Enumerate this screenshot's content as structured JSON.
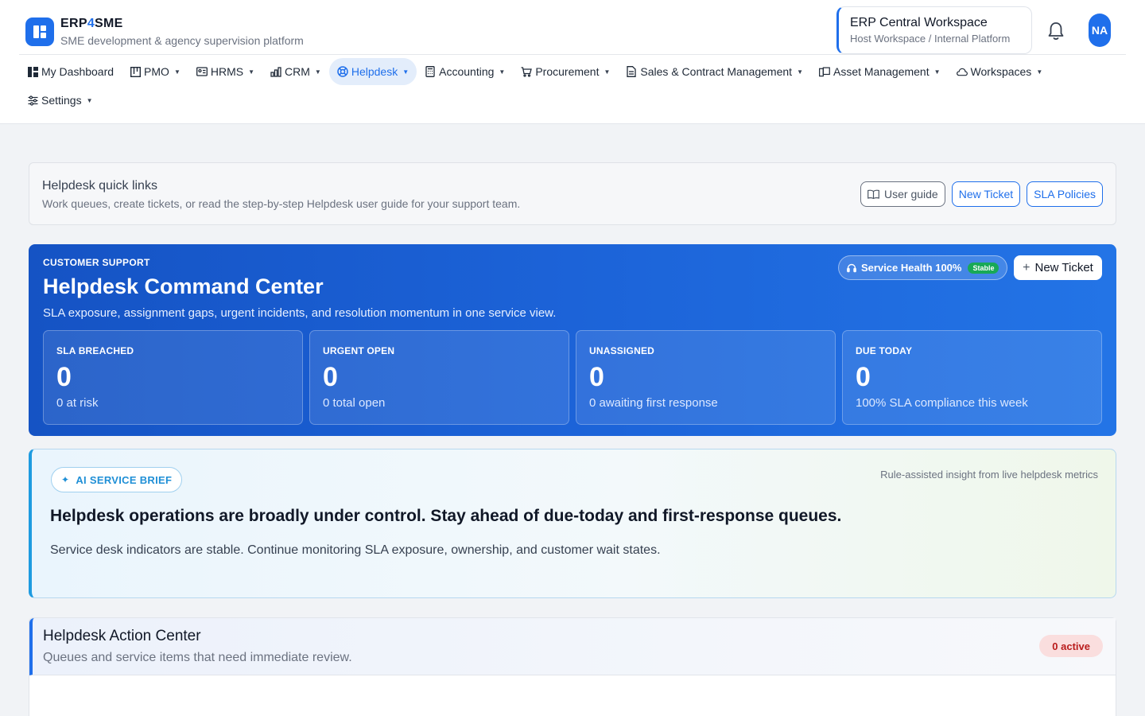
{
  "brand": {
    "name_prefix": "ERP",
    "name_four": "4",
    "name_suffix": "SME",
    "subtitle": "SME development & agency supervision platform",
    "color": "#1f6feb"
  },
  "workspace": {
    "title": "ERP Central Workspace",
    "subtitle": "Host Workspace / Internal Platform"
  },
  "user": {
    "initials": "NA"
  },
  "nav": {
    "items": [
      {
        "label": "My Dashboard",
        "icon": "dashboard-icon",
        "dropdown": false,
        "active": false
      },
      {
        "label": "PMO",
        "icon": "kanban-icon",
        "dropdown": true,
        "active": false
      },
      {
        "label": "HRMS",
        "icon": "id-card-icon",
        "dropdown": true,
        "active": false
      },
      {
        "label": "CRM",
        "icon": "bar-chart-icon",
        "dropdown": true,
        "active": false
      },
      {
        "label": "Helpdesk",
        "icon": "lifebuoy-icon",
        "dropdown": true,
        "active": true
      },
      {
        "label": "Accounting",
        "icon": "calculator-icon",
        "dropdown": true,
        "active": false
      },
      {
        "label": "Procurement",
        "icon": "cart-icon",
        "dropdown": true,
        "active": false
      },
      {
        "label": "Sales & Contract Management",
        "icon": "document-icon",
        "dropdown": true,
        "active": false
      },
      {
        "label": "Asset Management",
        "icon": "devices-icon",
        "dropdown": true,
        "active": false
      },
      {
        "label": "Workspaces",
        "icon": "cloud-icon",
        "dropdown": true,
        "active": false
      },
      {
        "label": "Settings",
        "icon": "sliders-icon",
        "dropdown": true,
        "active": false
      }
    ]
  },
  "quick_links": {
    "title": "Helpdesk quick links",
    "subtitle": "Work queues, create tickets, or read the step-by-step Helpdesk user guide for your support team.",
    "user_guide": "User guide",
    "new_ticket": "New Ticket",
    "sla_policies": "SLA Policies"
  },
  "command_center": {
    "eyebrow": "CUSTOMER SUPPORT",
    "title": "Helpdesk Command Center",
    "subtitle": "SLA exposure, assignment gaps, urgent incidents, and resolution momentum in one service view.",
    "health_label": "Service Health 100%",
    "health_badge": "Stable",
    "new_ticket": "New Ticket",
    "kpis": [
      {
        "label": "SLA BREACHED",
        "value": "0",
        "note": "0 at risk"
      },
      {
        "label": "URGENT OPEN",
        "value": "0",
        "note": "0 total open"
      },
      {
        "label": "UNASSIGNED",
        "value": "0",
        "note": "0 awaiting first response"
      },
      {
        "label": "DUE TODAY",
        "value": "0",
        "note": "100% SLA compliance this week"
      }
    ]
  },
  "ai_brief": {
    "chip": "AI SERVICE BRIEF",
    "meta": "Rule-assisted insight from live helpdesk metrics",
    "headline": "Helpdesk operations are broadly under control. Stay ahead of due-today and first-response queues.",
    "text": "Service desk indicators are stable. Continue monitoring SLA exposure, ownership, and customer wait states."
  },
  "action_center": {
    "title": "Helpdesk Action Center",
    "subtitle": "Queues and service items that need immediate review.",
    "badge": "0 active"
  }
}
